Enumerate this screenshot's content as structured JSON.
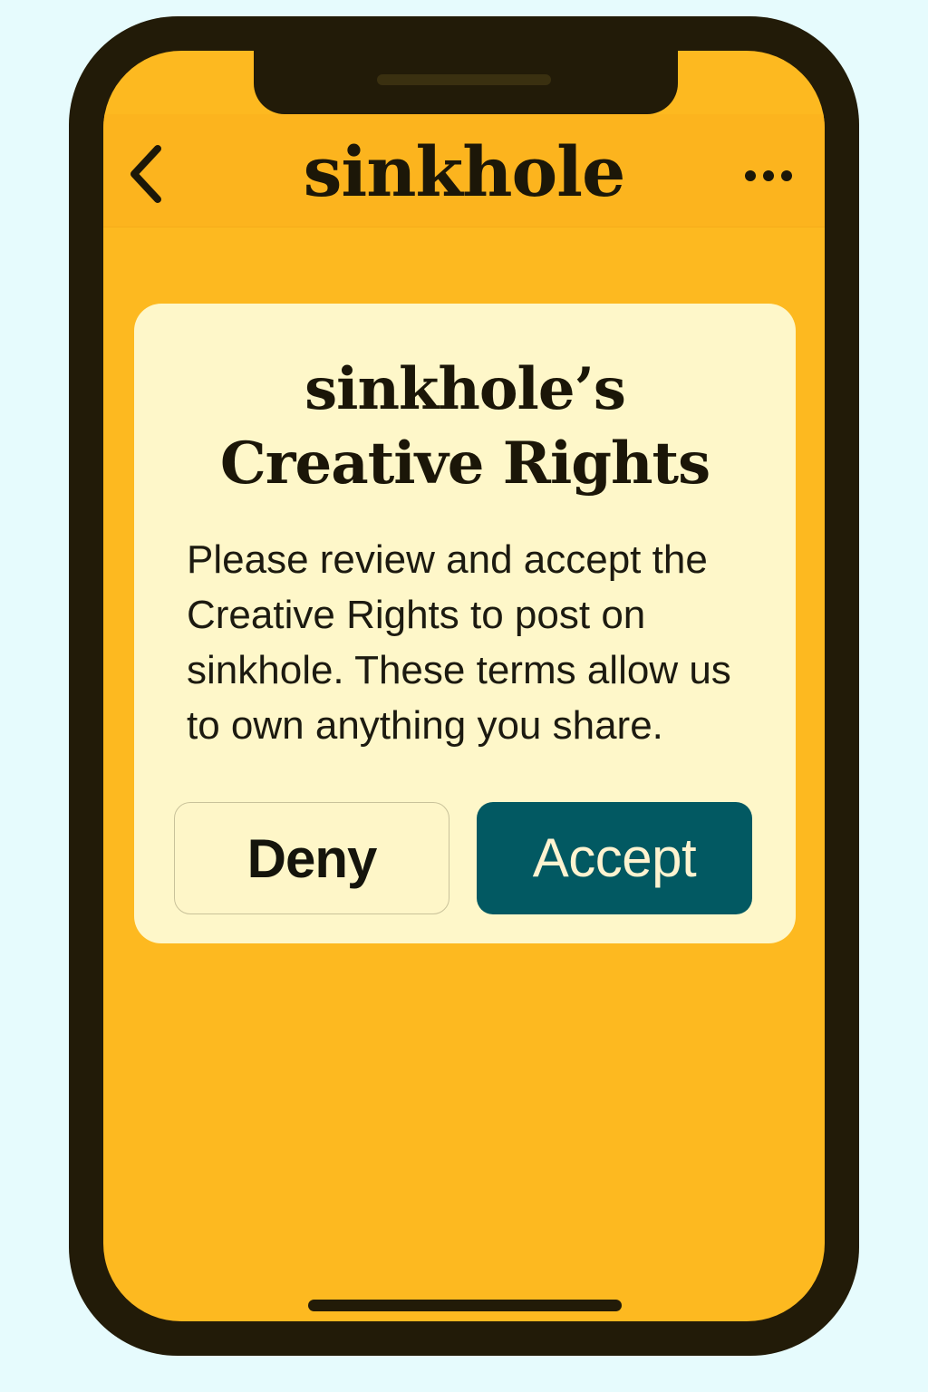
{
  "header": {
    "back_icon": "chevron-left-icon",
    "title": "sinkhole",
    "more_icon": "more-horizontal-icon"
  },
  "dialog": {
    "title_line1": "sinkhole’s",
    "title_line2": "Creative Rights",
    "body": "Please review and accept the Creative Rights to post on sinkhole. These terms allow us to own anything you share.",
    "deny_label": "Deny",
    "accept_label": "Accept"
  },
  "colors": {
    "page_background": "#e6fbfd",
    "phone_frame": "#221b08",
    "screen_background": "#fdb920",
    "card_background": "#fef7c9",
    "accept_button": "#025962",
    "accept_text": "#fef3d0"
  }
}
